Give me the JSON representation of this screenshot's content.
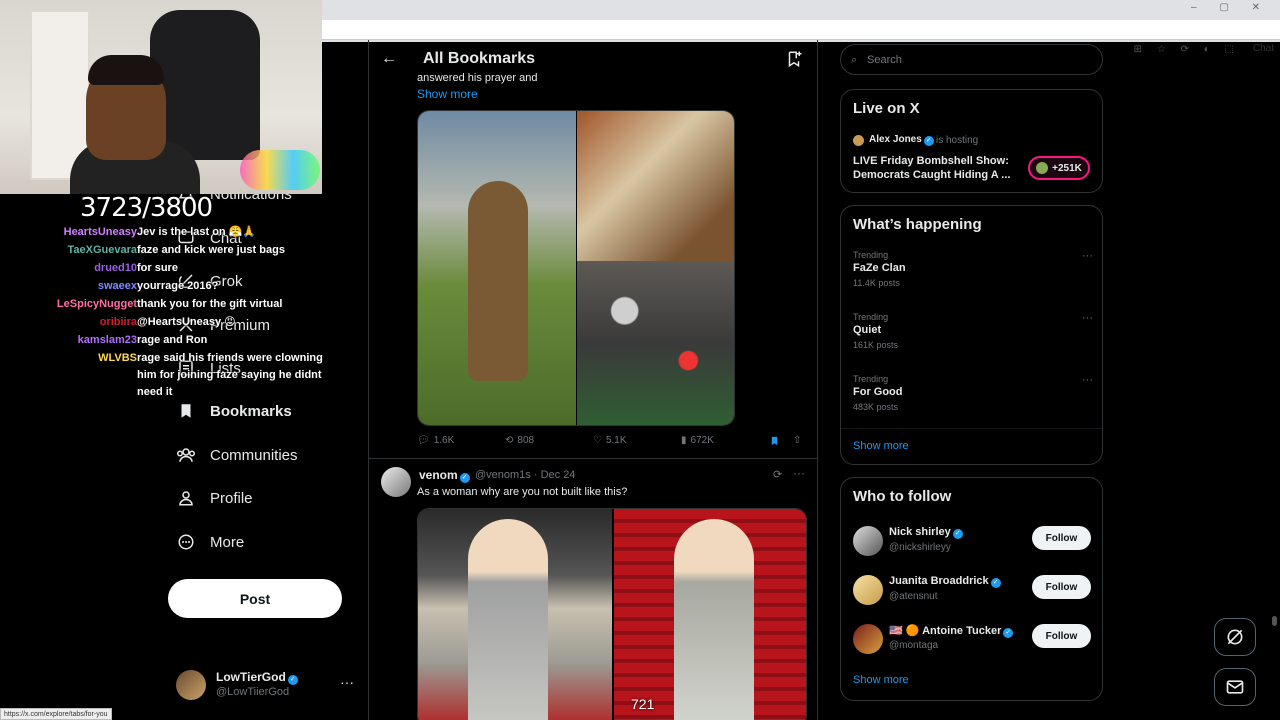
{
  "browser": {
    "controls": "– ▢ ✕",
    "chat_label": "Chat"
  },
  "overlay": {
    "sub_counter": "3723/3800",
    "chat": [
      {
        "user": "HeartsUneasy",
        "color": "#d17eff",
        "message": "Jev is the last on 😤🙏"
      },
      {
        "user": "TaeXGuevara",
        "color": "#5fb3a5",
        "message": "faze and kick were just bags"
      },
      {
        "user": "drued10",
        "color": "#9b5de5",
        "message": "for sure"
      },
      {
        "user": "swaeex",
        "color": "#7b8cff",
        "message": "yourrage 2016?"
      },
      {
        "user": "LeSpicyNugget",
        "color": "#ff6fa6",
        "message": "thank you for the gift virtual"
      },
      {
        "user": "oribiira",
        "color": "#d91e2a",
        "message": "@HeartsUneasy 😡"
      },
      {
        "user": "kamslam23",
        "color": "#b06cff",
        "message": "rage and Ron"
      },
      {
        "user": "WLVBS",
        "color": "#ffd84d",
        "message": "rage said his friends were clowning him for joining faze saying he didnt need it"
      }
    ],
    "status_url": "https://x.com/explore/tabs/for-you"
  },
  "nav": {
    "items": [
      {
        "label": "Notifications",
        "icon": "bell-icon"
      },
      {
        "label": "Chat",
        "icon": "chat-icon"
      },
      {
        "label": "Grok",
        "icon": "grok-icon"
      },
      {
        "label": "Premium",
        "icon": "x-icon"
      },
      {
        "label": "Lists",
        "icon": "list-icon"
      },
      {
        "label": "Bookmarks",
        "icon": "bookmark-icon"
      },
      {
        "label": "Communities",
        "icon": "communities-icon"
      },
      {
        "label": "Profile",
        "icon": "profile-icon"
      },
      {
        "label": "More",
        "icon": "more-icon"
      }
    ],
    "post_label": "Post",
    "account": {
      "name": "LowTierGod",
      "handle": "@LowTiierGod",
      "more": "···"
    }
  },
  "main": {
    "title": "All Bookmarks",
    "tweet1": {
      "text_tail": "answered his prayer and",
      "show_more": "Show more",
      "replies": "1.6K",
      "reposts": "808",
      "likes": "5.1K",
      "views": "672K"
    },
    "tweet2": {
      "name": "venom",
      "handle": "@venom1s · Dec 24",
      "text": "As a woman why are you not built like this?",
      "video_count": "721"
    }
  },
  "right": {
    "search_placeholder": "Search",
    "live": {
      "title": "Live on X",
      "host": "Alex Jones",
      "hosting": "is hosting",
      "show": "LIVE Friday Bombshell Show: Democrats Caught Hiding A ...",
      "listeners": "+251K"
    },
    "happening": {
      "title": "What’s happening",
      "trends": [
        {
          "label": "Trending",
          "name": "FaZe Clan",
          "count": "11.4K posts"
        },
        {
          "label": "Trending",
          "name": "Quiet",
          "count": "161K posts"
        },
        {
          "label": "Trending",
          "name": "For Good",
          "count": "483K posts"
        }
      ],
      "show_more": "Show more"
    },
    "follow": {
      "title": "Who to follow",
      "users": [
        {
          "name": "Nick shirley",
          "handle": "@nickshirleyy",
          "button": "Follow"
        },
        {
          "name": "Juanita Broaddrick",
          "handle": "@atensnut",
          "button": "Follow"
        },
        {
          "name": "🇺🇸 🟠 Antoine Tucker",
          "handle": "@montaga",
          "button": "Follow"
        }
      ],
      "show_more": "Show more"
    }
  }
}
